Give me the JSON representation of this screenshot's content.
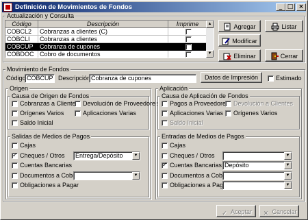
{
  "window": {
    "title": "Definición de Movimientos de Fondos",
    "min": "_",
    "max": "□",
    "close": "×"
  },
  "consulta": {
    "label": "Actualización y Consulta",
    "columns": [
      "Código",
      "Descripción",
      "Imprime"
    ],
    "rows": [
      {
        "code": "COBCL2",
        "desc": "Cobranzas a clientes (C)",
        "imprime": false,
        "selected": false
      },
      {
        "code": "COBCLI",
        "desc": "Cobranzas a clientes",
        "imprime": false,
        "selected": false
      },
      {
        "code": "COBCUP",
        "desc": "Cobranza de cupones",
        "imprime": false,
        "selected": true
      },
      {
        "code": "COBDOC",
        "desc": "Cobro de documentos",
        "imprime": false,
        "selected": false
      }
    ]
  },
  "actions": {
    "agregar": "Agregar",
    "listar": "Listar",
    "modificar": "Modificar",
    "eliminar": "Eliminar",
    "cerrar": "Cerrar"
  },
  "movimiento": {
    "label": "Movimiento de Fondos",
    "codigo_label": "Código:",
    "codigo_value": "COBCUP",
    "descripcion_label": "Descripción:",
    "descripcion_value": "Cobranza de cupones",
    "datos_impresion": "Datos de Impresión",
    "estimado_label": "Estimado"
  },
  "origen": {
    "label": "Origen",
    "causa_label": "Causa de Origen de Fondos",
    "causa": [
      {
        "label": "Cobranzas a Clientes",
        "checked": false,
        "disabled": false
      },
      {
        "label": "Devolución de Proveedores",
        "checked": false,
        "disabled": false
      },
      {
        "label": "Orígenes Varios",
        "checked": false,
        "disabled": false
      },
      {
        "label": "Aplicaciones Varias",
        "checked": false,
        "disabled": false
      },
      {
        "label": "Saldo Inicial",
        "checked": false,
        "disabled": false
      }
    ],
    "salidas_label": "Salidas de Medios de Pagos",
    "salidas": [
      {
        "label": "Cajas",
        "checked": false,
        "combo": null
      },
      {
        "label": "Cheques / Otros",
        "checked": true,
        "combo": "Entrega/Depósito"
      },
      {
        "label": "Cuentas Bancarias",
        "checked": false,
        "combo": null
      },
      {
        "label": "Documentos a Cobrar",
        "checked": false,
        "combo": ""
      },
      {
        "label": "Obligaciones a Pagar",
        "checked": false,
        "combo": null
      }
    ]
  },
  "aplicacion": {
    "label": "Aplicación",
    "causa_label": "Causa de Aplicación de Fondos",
    "causa": [
      {
        "label": "Pagos a Proveedores",
        "checked": false,
        "disabled": false
      },
      {
        "label": "Devolución a Clientes",
        "checked": false,
        "disabled": true
      },
      {
        "label": "Aplicaciones Varias",
        "checked": false,
        "disabled": false
      },
      {
        "label": "Orígenes Varios",
        "checked": false,
        "disabled": false
      },
      {
        "label": "Saldo Inicial",
        "checked": false,
        "disabled": true
      }
    ],
    "entradas_label": "Entradas de Medios de Pagos",
    "entradas": [
      {
        "label": "Cajas",
        "checked": false,
        "combo": null
      },
      {
        "label": "Cheques / Otros",
        "checked": false,
        "combo": ""
      },
      {
        "label": "Cuentas Bancarias",
        "checked": true,
        "combo": "Depósito"
      },
      {
        "label": "Documentos a Cobrar",
        "checked": false,
        "combo": ""
      },
      {
        "label": "Obligaciones a Pagar",
        "checked": false,
        "combo": ""
      }
    ]
  },
  "footer": {
    "aceptar": "Aceptar",
    "cancelar": "Cancelar"
  },
  "icons": {
    "agregar": "new-document-icon",
    "listar": "printer-icon",
    "modificar": "pencil-icon",
    "eliminar": "delete-icon",
    "cerrar": "exit-door-icon",
    "aceptar": "check-icon",
    "cancelar": "cross-icon"
  }
}
